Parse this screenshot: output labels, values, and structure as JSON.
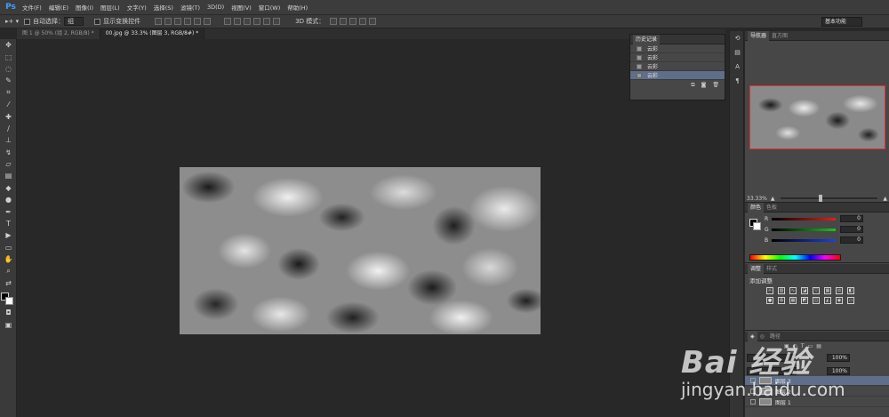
{
  "app": {
    "logo": "Ps"
  },
  "menubar": {
    "items": [
      "文件(F)",
      "编辑(E)",
      "图像(I)",
      "图层(L)",
      "文字(Y)",
      "选择(S)",
      "滤镜(T)",
      "3D(D)",
      "视图(V)",
      "窗口(W)",
      "帮助(H)"
    ]
  },
  "options": {
    "auto_select_label": "自动选择：",
    "auto_select_value": "组",
    "show_transform_label": "显示变换控件",
    "mode_3d_label": "3D 模式：",
    "workspace": "基本功能"
  },
  "tabs": [
    {
      "label": "图 1 @ 50% (组 2, RGB/8) *"
    },
    {
      "label": "00.jpg @ 33.3% (图层 3, RGB/8#) *"
    }
  ],
  "history": {
    "tab": "历史记录",
    "items": [
      "云彩",
      "云彩",
      "云彩",
      "云彩"
    ]
  },
  "navigator": {
    "tab1": "导航器",
    "tab2": "直方图",
    "zoom": "33.33%"
  },
  "color": {
    "tab1": "颜色",
    "tab2": "色板",
    "r_label": "R",
    "g_label": "G",
    "b_label": "B",
    "r": "0",
    "g": "0",
    "b": "0",
    "fg": "#000000",
    "bg": "#ffffff"
  },
  "adjustments": {
    "tab1": "调整",
    "tab2": "样式",
    "title": "添加调整"
  },
  "layers": {
    "tab2": "路径",
    "opacity": "100%",
    "fill": "100%",
    "rows": [
      "图层 3",
      "图层 2",
      "图层 1"
    ]
  },
  "watermark": {
    "logo": "Bai 经验",
    "url": "jingyan.baidu.com"
  }
}
